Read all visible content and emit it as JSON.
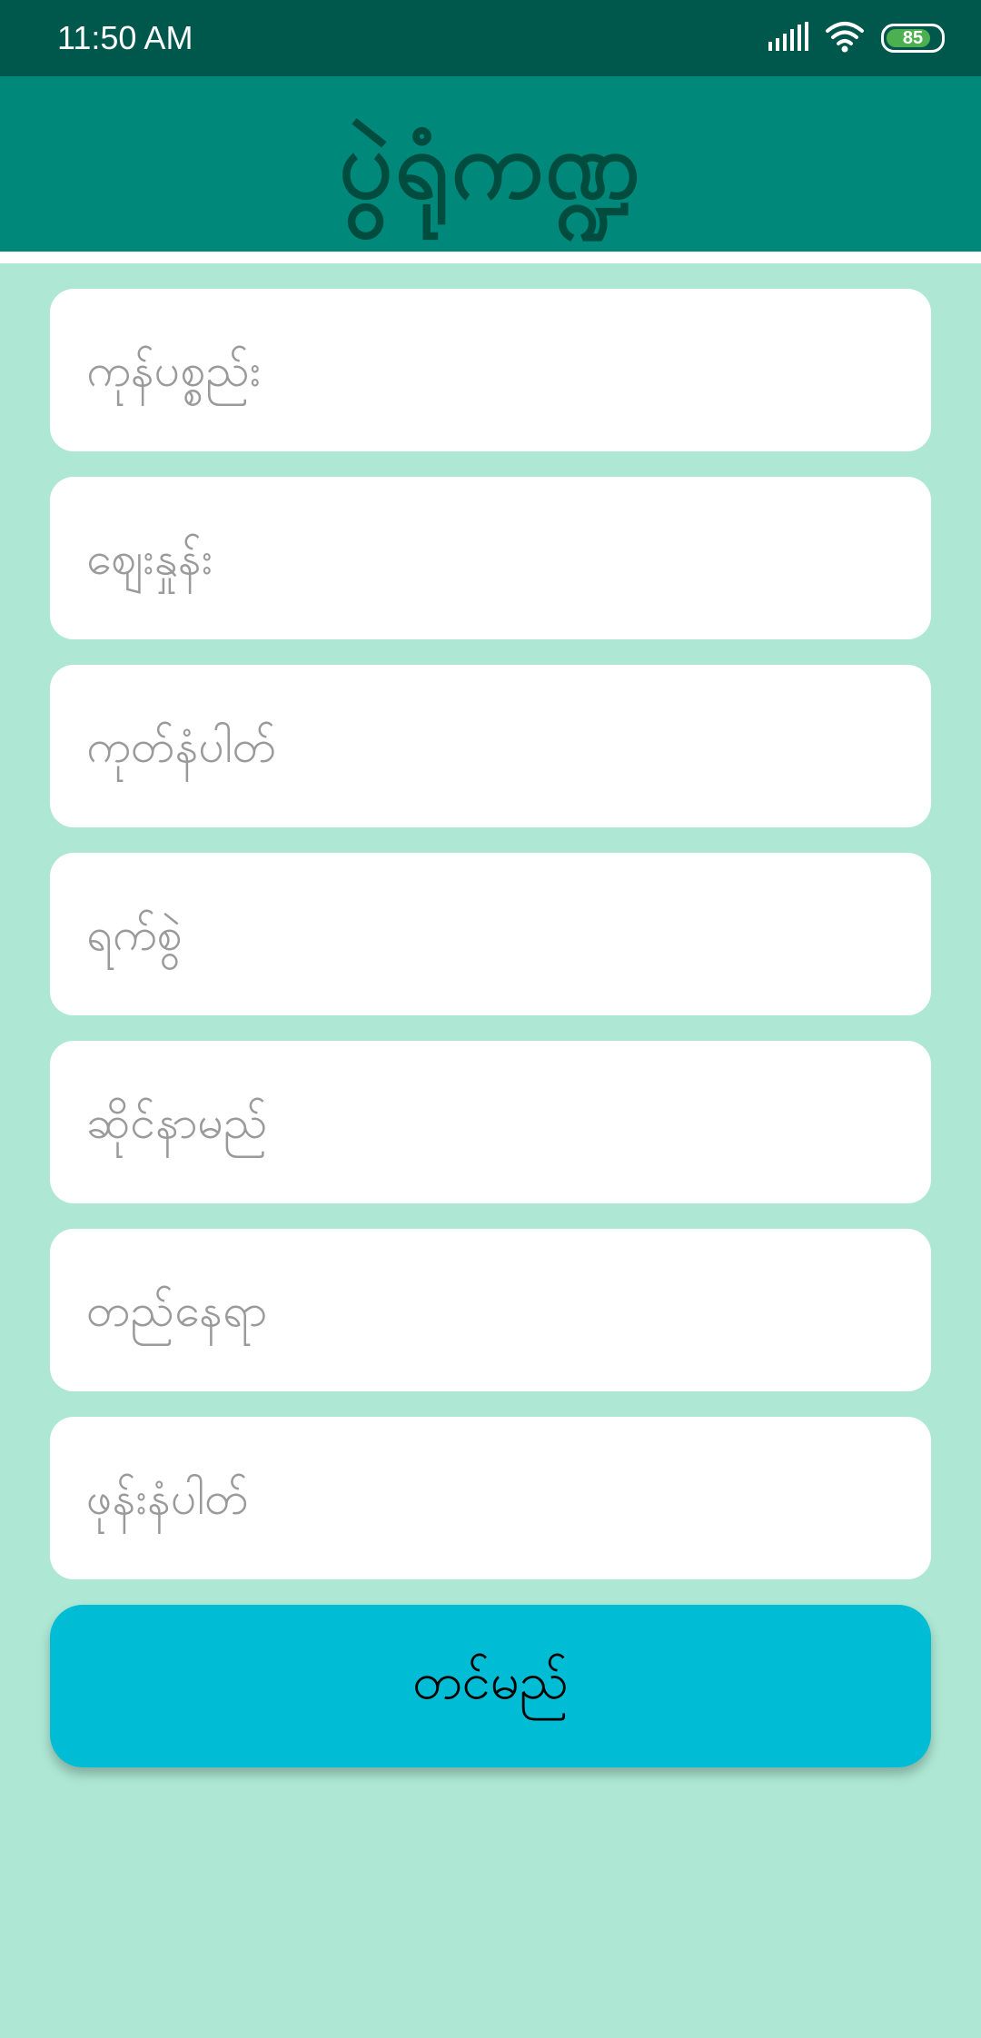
{
  "status_bar": {
    "time": "11:50 AM",
    "battery_percent": 85
  },
  "app_bar": {
    "title": "ပွဲရုံကဏ္ဍ"
  },
  "form": {
    "fields": [
      {
        "placeholder": "ကုန်ပစ္စည်း",
        "value": ""
      },
      {
        "placeholder": "ဈေးနှုန်း",
        "value": ""
      },
      {
        "placeholder": "ကုတ်နံပါတ်",
        "value": ""
      },
      {
        "placeholder": "ရက်စွဲ",
        "value": ""
      },
      {
        "placeholder": "ဆိုင်နာမည်",
        "value": ""
      },
      {
        "placeholder": "တည်နေရာ",
        "value": ""
      },
      {
        "placeholder": "ဖုန်းနံပါတ်",
        "value": ""
      }
    ],
    "submit_label": "တင်မည်"
  },
  "colors": {
    "status_bar": "#00574b",
    "app_bar": "#00897b",
    "title_text": "#004d40",
    "background": "#aee8d5",
    "button": "#00bcd4",
    "battery_fill": "#4caf50"
  },
  "icons": [
    "signal-icon",
    "wifi-icon",
    "battery-icon"
  ]
}
